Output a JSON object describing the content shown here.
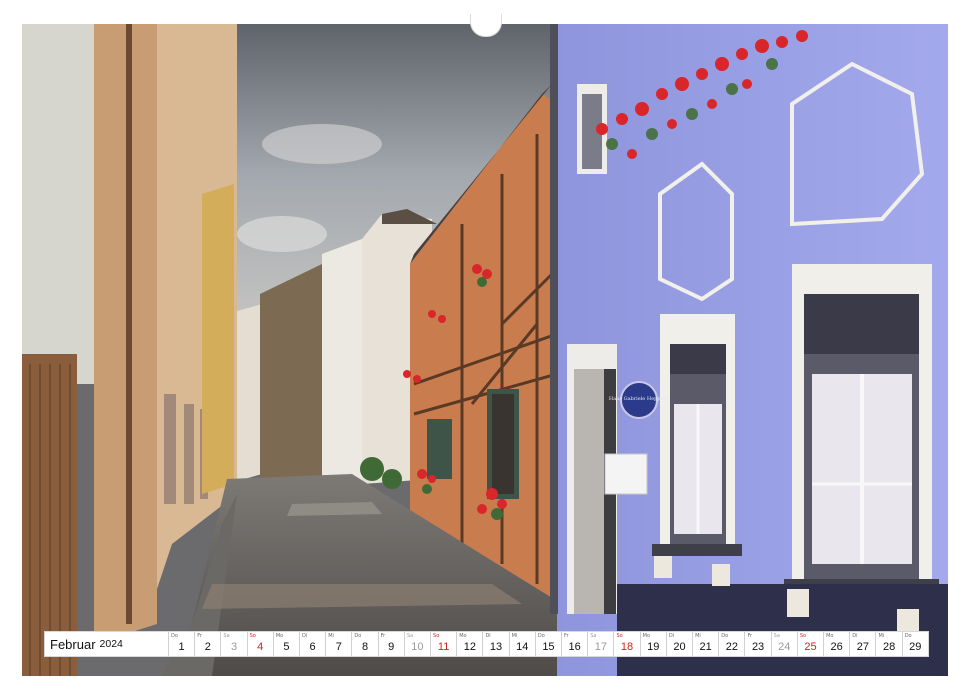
{
  "calendar": {
    "month": "Februar",
    "year": "2024",
    "days": [
      {
        "dn": "Do",
        "num": "1",
        "type": "weekday"
      },
      {
        "dn": "Fr",
        "num": "2",
        "type": "weekday"
      },
      {
        "dn": "Sa",
        "num": "3",
        "type": "sat"
      },
      {
        "dn": "So",
        "num": "4",
        "type": "sun"
      },
      {
        "dn": "Mo",
        "num": "5",
        "type": "weekday"
      },
      {
        "dn": "Di",
        "num": "6",
        "type": "weekday"
      },
      {
        "dn": "Mi",
        "num": "7",
        "type": "weekday"
      },
      {
        "dn": "Do",
        "num": "8",
        "type": "weekday"
      },
      {
        "dn": "Fr",
        "num": "9",
        "type": "weekday"
      },
      {
        "dn": "Sa",
        "num": "10",
        "type": "sat"
      },
      {
        "dn": "So",
        "num": "11",
        "type": "sun"
      },
      {
        "dn": "Mo",
        "num": "12",
        "type": "weekday"
      },
      {
        "dn": "Di",
        "num": "13",
        "type": "weekday"
      },
      {
        "dn": "Mi",
        "num": "14",
        "type": "weekday"
      },
      {
        "dn": "Do",
        "num": "15",
        "type": "weekday"
      },
      {
        "dn": "Fr",
        "num": "16",
        "type": "weekday"
      },
      {
        "dn": "Sa",
        "num": "17",
        "type": "sat"
      },
      {
        "dn": "So",
        "num": "18",
        "type": "sun"
      },
      {
        "dn": "Mo",
        "num": "19",
        "type": "weekday"
      },
      {
        "dn": "Di",
        "num": "20",
        "type": "weekday"
      },
      {
        "dn": "Mi",
        "num": "21",
        "type": "weekday"
      },
      {
        "dn": "Do",
        "num": "22",
        "type": "weekday"
      },
      {
        "dn": "Fr",
        "num": "23",
        "type": "weekday"
      },
      {
        "dn": "Sa",
        "num": "24",
        "type": "sat"
      },
      {
        "dn": "So",
        "num": "25",
        "type": "sun"
      },
      {
        "dn": "Mo",
        "num": "26",
        "type": "weekday"
      },
      {
        "dn": "Di",
        "num": "27",
        "type": "weekday"
      },
      {
        "dn": "Mi",
        "num": "28",
        "type": "weekday"
      },
      {
        "dn": "Do",
        "num": "29",
        "type": "weekday"
      }
    ]
  },
  "photo": {
    "sign_text": "Haus Gabriele Heppner",
    "colors": {
      "sky": "#8d949c",
      "blue_house": "#9aa0e4",
      "orange_house": "#c97d4f",
      "cobblestone": "#5e5b58",
      "flowers": "#d8262a"
    }
  }
}
